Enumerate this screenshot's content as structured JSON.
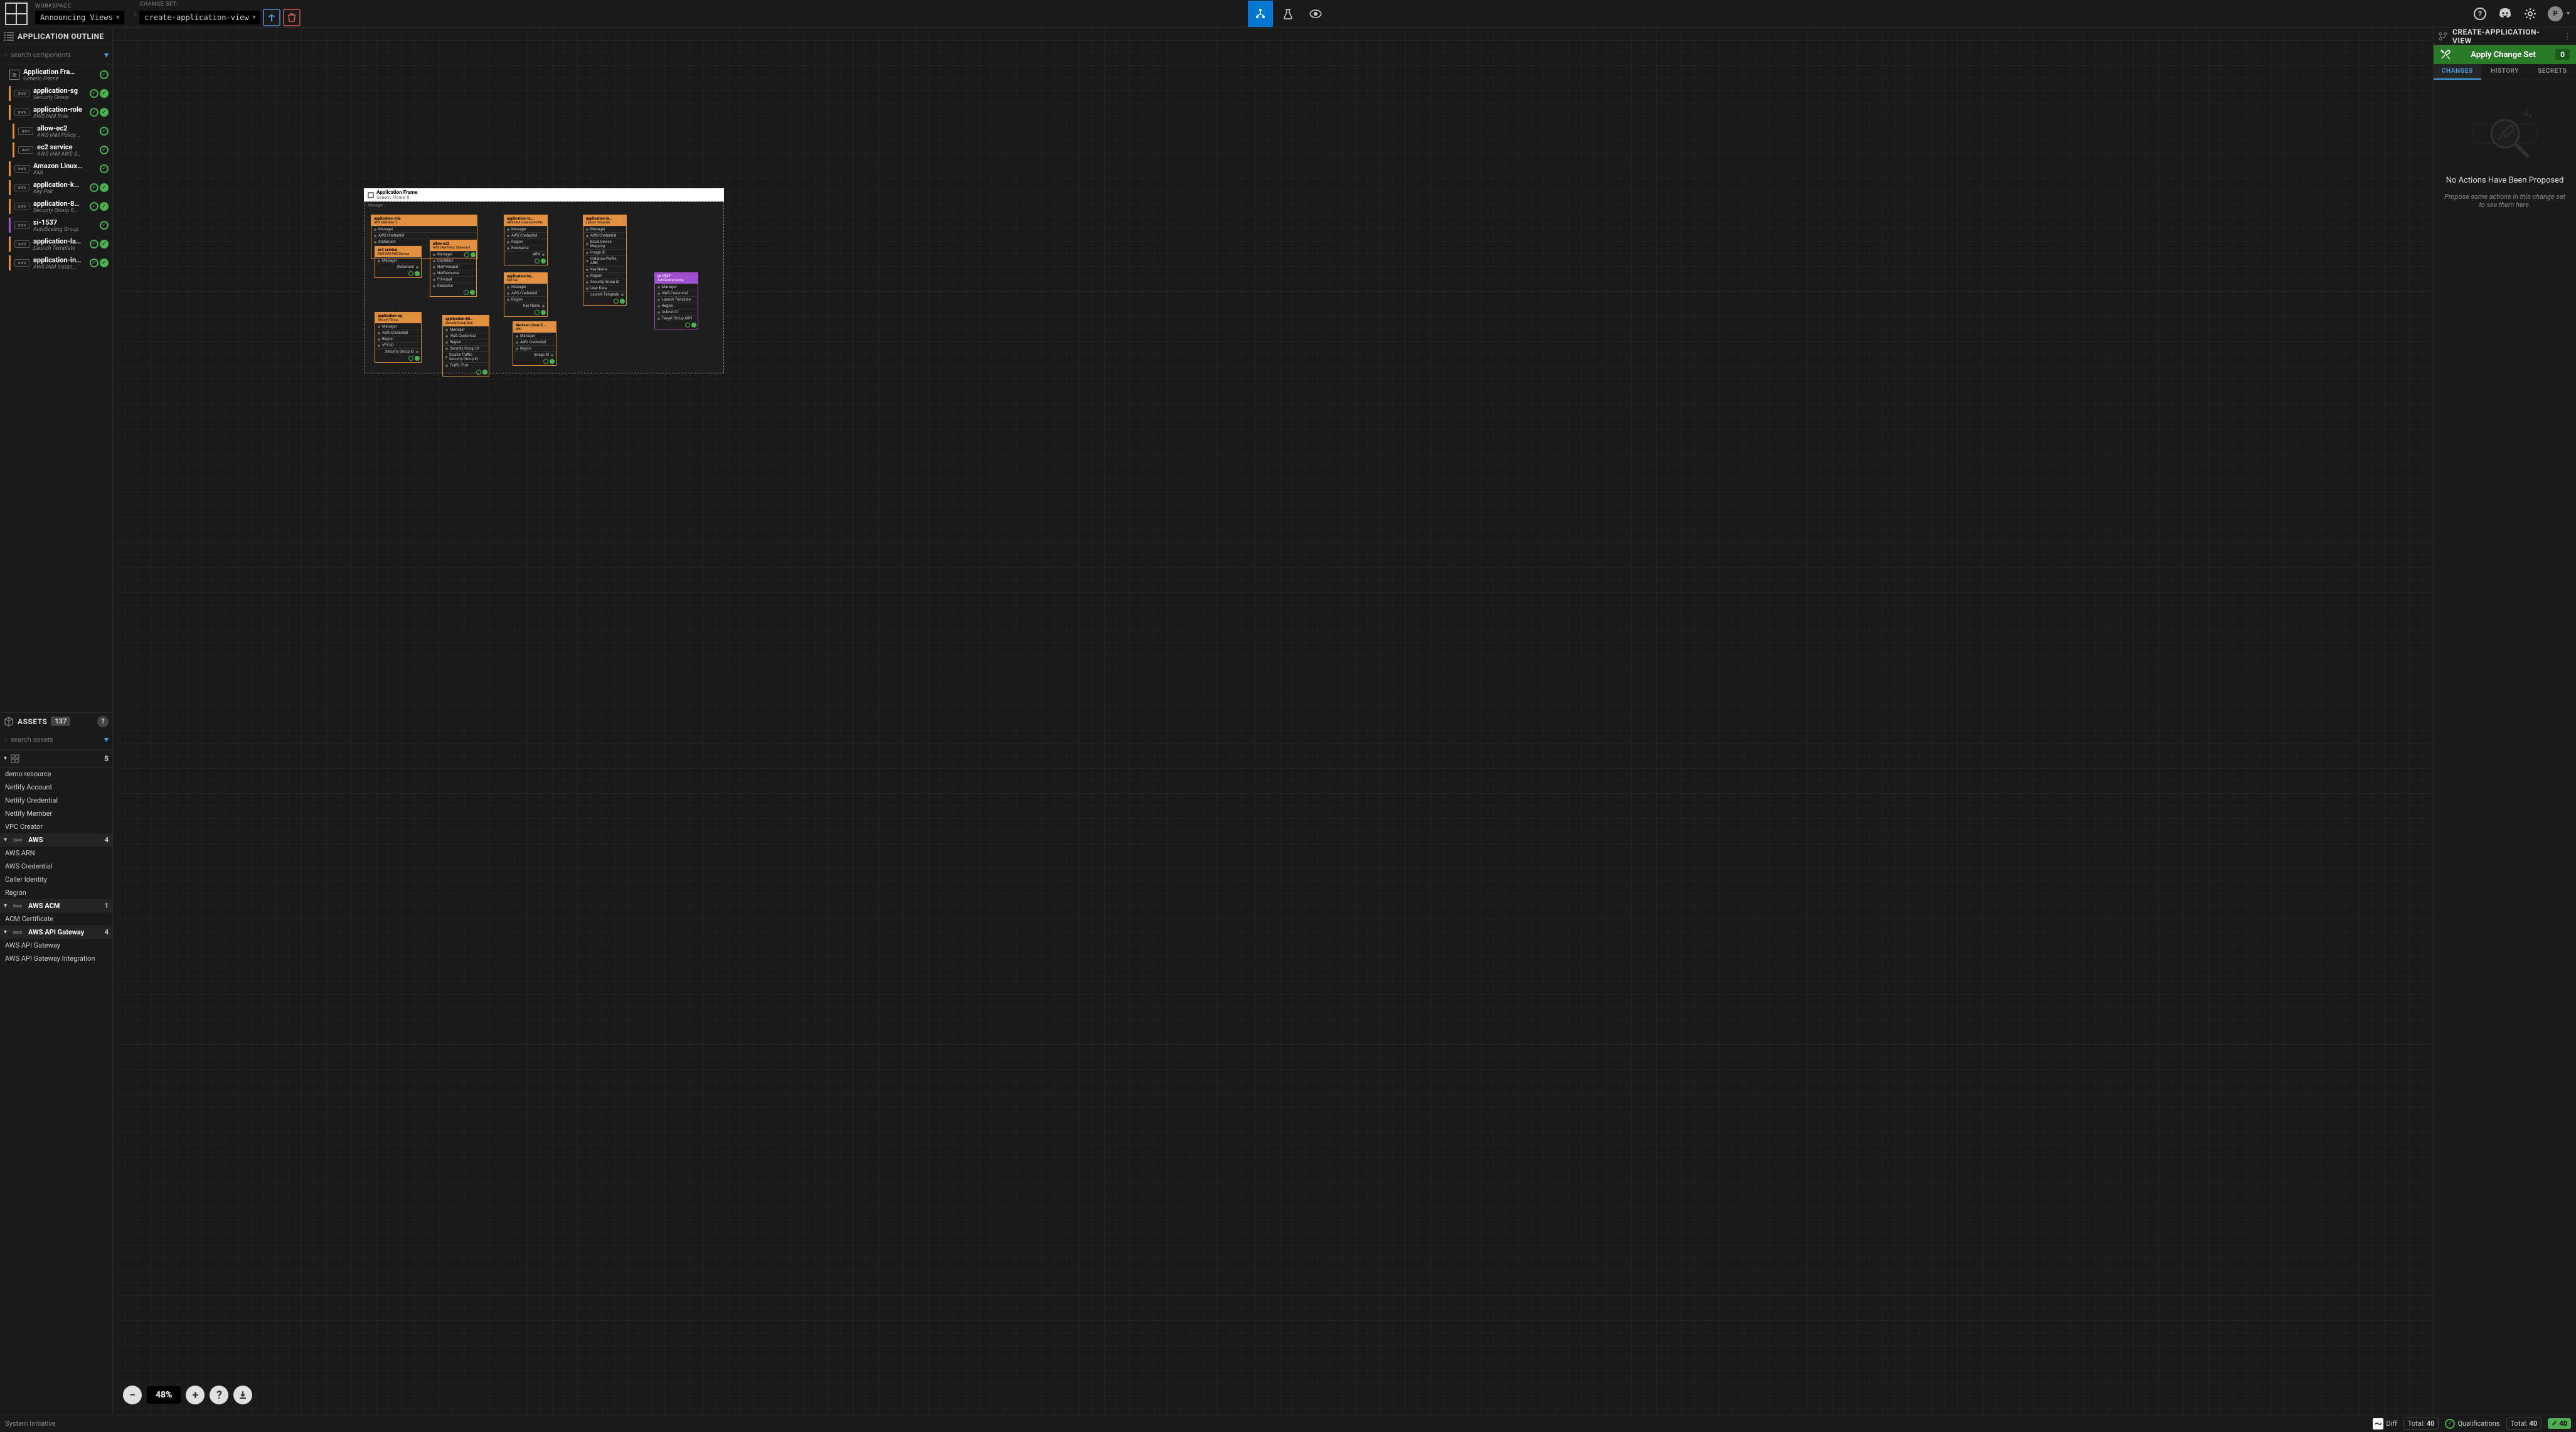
{
  "top": {
    "workspace_label": "WORKSPACE:",
    "workspace_value": "Announcing Views",
    "changeset_label": "CHANGE SET:",
    "changeset_value": "create-application-view"
  },
  "avatar": "P",
  "left": {
    "outline_title": "APPLICATION OUTLINE",
    "search_placeholder": "search components",
    "items": [
      {
        "name": "Application Fra…",
        "sub": "Generic Frame",
        "indent": 0,
        "bar": "",
        "two": false,
        "frame": true
      },
      {
        "name": "application-sg",
        "sub": "Security Group",
        "indent": 1,
        "bar": "orange",
        "two": true
      },
      {
        "name": "application-role",
        "sub": "AWS IAM Role",
        "indent": 1,
        "bar": "orange",
        "two": true
      },
      {
        "name": "allow-ec2",
        "sub": "AWS IAM Policy …",
        "indent": 2,
        "bar": "orange",
        "two": false
      },
      {
        "name": "ec2 service",
        "sub": "AWS IAM AWS S…",
        "indent": 2,
        "bar": "orange",
        "two": false
      },
      {
        "name": "Amazon Linux…",
        "sub": "AMI",
        "indent": 1,
        "bar": "orange",
        "two": false
      },
      {
        "name": "application-k…",
        "sub": "Key Pair",
        "indent": 1,
        "bar": "orange",
        "two": true
      },
      {
        "name": "application-8…",
        "sub": "Security Group R…",
        "indent": 1,
        "bar": "orange",
        "two": true
      },
      {
        "name": "si-1537",
        "sub": "AutoScaling Group",
        "indent": 1,
        "bar": "purple",
        "two": false
      },
      {
        "name": "application-la…",
        "sub": "Launch Template",
        "indent": 1,
        "bar": "orange",
        "two": true
      },
      {
        "name": "application-in…",
        "sub": "AWS IAM Instan…",
        "indent": 1,
        "bar": "orange",
        "two": true
      }
    ],
    "assets_title": "ASSETS",
    "assets_count": "137",
    "assets_search": "search assets",
    "filter_count": "5",
    "loose": [
      "demo resource",
      "Netlify Account",
      "Netlify Credential",
      "Netlify Member",
      "VPC Creator"
    ],
    "groups": [
      {
        "name": "AWS",
        "count": "4",
        "items": [
          "AWS ARN",
          "AWS Credential",
          "Caller Identity",
          "Region"
        ]
      },
      {
        "name": "AWS ACM",
        "count": "1",
        "items": [
          "ACM Certificate"
        ]
      },
      {
        "name": "AWS API Gateway",
        "count": "4",
        "items": [
          "AWS API Gateway",
          "AWS API Gateway Integration"
        ]
      }
    ]
  },
  "canvas": {
    "zoom": "48%",
    "frame": {
      "title": "Application Frame",
      "sub": "Generic Frame: 8",
      "manager": "Manager"
    },
    "nodes": {
      "role": {
        "title": "application-role",
        "sub": "AWS IAM Role: 2",
        "rows": [
          "Manager",
          "AWS Credential",
          "Statement"
        ],
        "out": "Principal"
      },
      "ec2svc": {
        "title": "ec2 service",
        "sub": "AWS IAM AWS Service",
        "rows": [
          "Manager"
        ],
        "out": "Statement"
      },
      "allow": {
        "title": "allow-ec2",
        "sub": "AWS IAM Policy Statement",
        "rows": [
          "Manager",
          "Condition",
          "NotPrincipal",
          "NotResource",
          "Principal",
          "Resource"
        ]
      },
      "sg": {
        "title": "application-sg",
        "sub": "Security Group",
        "rows": [
          "Manager",
          "AWS Credential",
          "Region",
          "VPC ID"
        ],
        "out": "Security Group ID"
      },
      "sgr": {
        "title": "application-80…",
        "sub": "Security Group Rule",
        "rows": [
          "Manager",
          "AWS Credential",
          "Region",
          "Security Group ID",
          "Source Traffic Security Group ID",
          "Traffic Port"
        ]
      },
      "inst": {
        "title": "application-ro…",
        "sub": "AWS IAM Instance Profile",
        "rows": [
          "Manager",
          "AWS Credential",
          "Region",
          "RoleName"
        ],
        "out": "ARN"
      },
      "kp": {
        "title": "application-ke…",
        "sub": "Key Pair",
        "rows": [
          "Manager",
          "AWS Credential",
          "Region"
        ],
        "out": "Key Name"
      },
      "ami": {
        "title": "Amazon Linux 2…",
        "sub": "AMI",
        "rows": [
          "Manager",
          "AWS Credential",
          "Region"
        ],
        "out": "Image ID"
      },
      "lt": {
        "title": "application-la…",
        "sub": "Launch Template",
        "rows": [
          "Manager",
          "AWS Credential",
          "Block Device Mapping",
          "Image ID",
          "Instance Profile ARN",
          "Key Name",
          "Region",
          "Security Group ID",
          "User Data"
        ],
        "out": "Launch Template"
      },
      "asg": {
        "title": "si-1537",
        "sub": "AutoScaling Group",
        "rows": [
          "Manager",
          "AWS Credential",
          "Launch Template",
          "Region",
          "Subnet ID",
          "Target Group ARN"
        ]
      }
    }
  },
  "right": {
    "title": "CREATE-APPLICATION-VIEW",
    "apply_label": "Apply Change Set",
    "apply_count": "0",
    "tabs": [
      "CHANGES",
      "HISTORY",
      "SECRETS"
    ],
    "empty_title": "No Actions Have Been Proposed",
    "empty_sub": "Propose some actions in this change set to see them here."
  },
  "bottom": {
    "brand": "System Initiative",
    "diff": "Diff",
    "total_label": "Total:",
    "total": "40",
    "qual": "Qualifications",
    "qual_total": "40",
    "qual_badge": "40"
  }
}
